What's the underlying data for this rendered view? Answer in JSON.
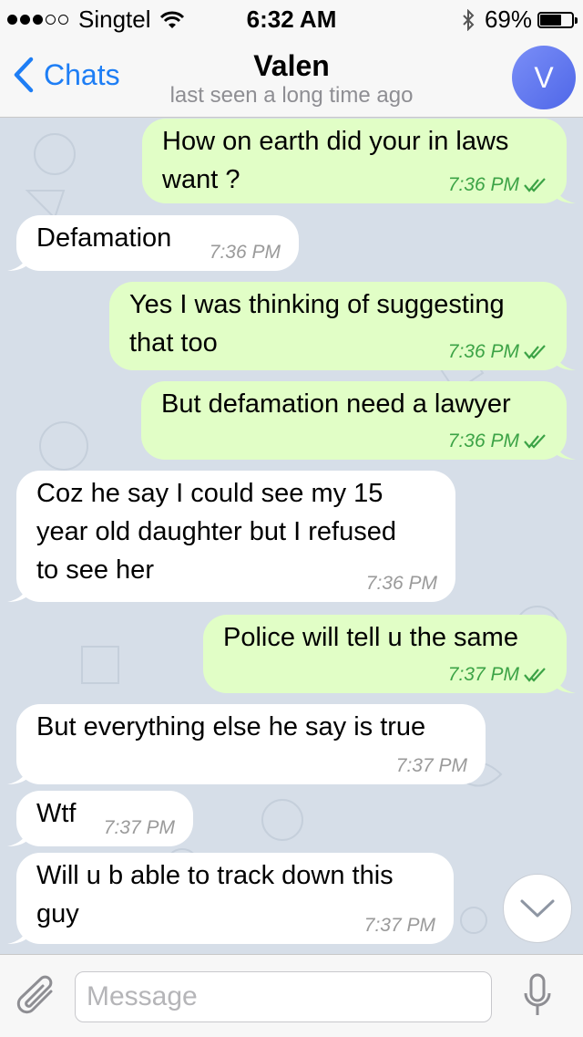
{
  "status_bar": {
    "carrier": "Singtel",
    "time": "6:32 AM",
    "battery": "69%",
    "battery_level": 0.69,
    "icons": [
      "signal-dots-icon",
      "wifi-icon",
      "bluetooth-icon",
      "battery-icon"
    ]
  },
  "nav": {
    "back_label": "Chats",
    "title": "Valen",
    "subtitle": "last seen a long time ago",
    "avatar_letter": "V"
  },
  "messages": [
    {
      "dir": "out",
      "lines": [
        "How on earth did your in laws",
        "want ?"
      ],
      "time": "7:36 PM",
      "read": true
    },
    {
      "dir": "in",
      "lines": [
        "Defamation"
      ],
      "time": "7:36 PM"
    },
    {
      "dir": "out",
      "lines": [
        "Yes I was thinking of suggesting",
        "that too"
      ],
      "time": "7:36 PM",
      "read": true
    },
    {
      "dir": "out",
      "lines": [
        "But defamation need a lawyer"
      ],
      "time": "7:36 PM",
      "read": true
    },
    {
      "dir": "in",
      "lines": [
        "Coz he say I could see my 15",
        "year old daughter but I refused",
        "to see her"
      ],
      "time": "7:36 PM"
    },
    {
      "dir": "out",
      "lines": [
        "Police will tell u the same"
      ],
      "time": "7:37 PM",
      "read": true
    },
    {
      "dir": "in",
      "lines": [
        "But everything else he say is true"
      ],
      "time": "7:37 PM"
    },
    {
      "dir": "in",
      "lines": [
        "Wtf"
      ],
      "time": "7:37 PM"
    },
    {
      "dir": "in",
      "lines": [
        "Will u b able to track down this",
        "guy"
      ],
      "time": "7:37 PM"
    }
  ],
  "input": {
    "placeholder": "Message",
    "value": ""
  },
  "colors": {
    "accent": "#1e7ef5",
    "outgoing_bubble": "#e1fec6",
    "incoming_bubble": "#ffffff",
    "outgoing_time": "#3ca346",
    "chat_background": "#d6dee8"
  }
}
